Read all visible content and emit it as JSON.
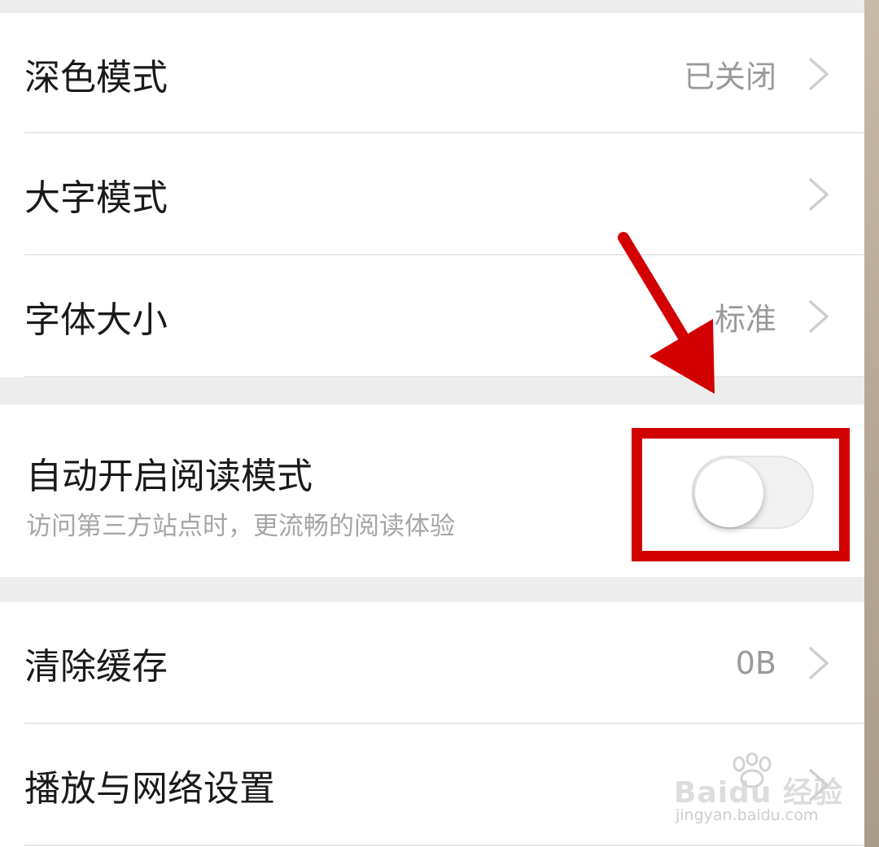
{
  "settings": {
    "dark_mode": {
      "label": "深色模式",
      "value": "已关闭"
    },
    "large_text_mode": {
      "label": "大字模式"
    },
    "font_size": {
      "label": "字体大小",
      "value": "标准"
    },
    "auto_reading_mode": {
      "label": "自动开启阅读模式",
      "subtitle": "访问第三方站点时，更流畅的阅读体验",
      "toggle_on": false
    },
    "clear_cache": {
      "label": "清除缓存",
      "value": "0B"
    },
    "playback_network": {
      "label": "播放与网络设置"
    }
  },
  "watermark": {
    "brand": "Baidu 经验",
    "url": "jingyan.baidu.com"
  },
  "icons": {
    "chevron": "chevron-right-icon",
    "annotation_arrow": "red-arrow-icon",
    "paw": "baidu-paw-icon"
  },
  "colors": {
    "annotation_red": "#d20000",
    "section_gap": "#ededed",
    "label_text": "#1a1a1a",
    "secondary_text": "#9a9a9a"
  }
}
